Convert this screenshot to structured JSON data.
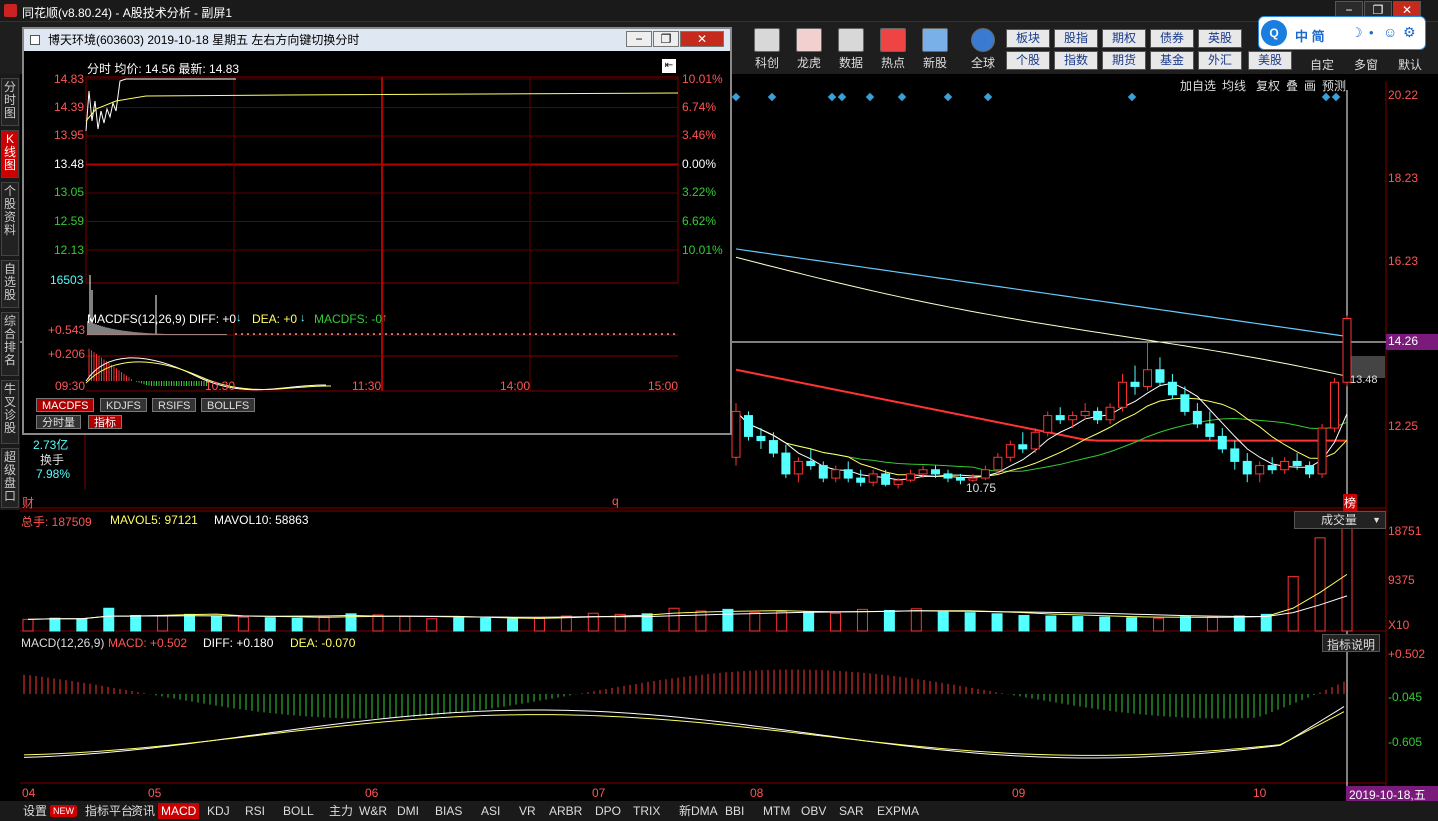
{
  "window": {
    "title": "同花顺(v8.80.24) - A股技术分析 - 副屏1",
    "controls": [
      "−",
      "❐",
      "✕"
    ]
  },
  "toolbar": {
    "tools": [
      {
        "label": "科创",
        "icon": "chart-icon"
      },
      {
        "label": "龙虎",
        "icon": "dragon-icon"
      },
      {
        "label": "数据",
        "icon": "pe-icon"
      },
      {
        "label": "热点",
        "icon": "hot-icon"
      },
      {
        "label": "新股",
        "icon": "ipo-icon"
      },
      {
        "label": "全球",
        "icon": "globe-icon"
      }
    ],
    "market_row1": [
      "板块",
      "股指",
      "期权",
      "债券",
      "英股"
    ],
    "market_row2": [
      "个股",
      "指数",
      "期货",
      "基金",
      "外汇",
      "美股"
    ],
    "right_tools": [
      "自定",
      "多窗",
      "默认"
    ],
    "search_text": "中 简"
  },
  "leftnav": [
    {
      "label": "分时图",
      "active": false
    },
    {
      "label": "K线图",
      "active": true
    },
    {
      "label": "个股资料",
      "active": false
    },
    {
      "label": "自选股",
      "active": false
    },
    {
      "label": "综合排名",
      "active": false
    },
    {
      "label": "牛叉诊股",
      "active": false
    },
    {
      "label": "超级盘口",
      "active": false
    }
  ],
  "kline": {
    "top_buttons": [
      "加自选",
      "均线",
      "复权",
      "叠",
      "画",
      "预测"
    ],
    "price_ticks": [
      "20.22",
      "18.23",
      "16.23",
      "14.26",
      "12.25"
    ],
    "current_price_tag": "14.26",
    "marker_label": "13.48",
    "low_label": "10.75",
    "side_info": {
      "amount": "2.73亿",
      "turnover_label": "换手",
      "turnover_value": "7.98%"
    },
    "bottom_markers": [
      "财",
      "q",
      "榜"
    ],
    "candles": [
      [
        11.5,
        12.8,
        11.3,
        12.6
      ],
      [
        12.5,
        12.6,
        11.9,
        12.0
      ],
      [
        12.0,
        12.2,
        11.7,
        11.9
      ],
      [
        11.9,
        12.1,
        11.5,
        11.6
      ],
      [
        11.6,
        11.8,
        11.0,
        11.1
      ],
      [
        11.1,
        11.5,
        10.9,
        11.4
      ],
      [
        11.4,
        11.7,
        11.2,
        11.3
      ],
      [
        11.3,
        11.4,
        10.9,
        11.0
      ],
      [
        11.0,
        11.3,
        10.9,
        11.2
      ],
      [
        11.2,
        11.4,
        10.9,
        11.0
      ],
      [
        11.0,
        11.2,
        10.8,
        10.9
      ],
      [
        10.9,
        11.2,
        10.8,
        11.1
      ],
      [
        11.1,
        11.2,
        10.8,
        10.85
      ],
      [
        10.85,
        11.0,
        10.75,
        10.95
      ],
      [
        10.95,
        11.2,
        10.9,
        11.1
      ],
      [
        11.1,
        11.3,
        11.0,
        11.2
      ],
      [
        11.2,
        11.3,
        11.0,
        11.1
      ],
      [
        11.1,
        11.2,
        10.9,
        11.0
      ],
      [
        11.0,
        11.1,
        10.85,
        10.95
      ],
      [
        10.95,
        11.1,
        10.9,
        11.0
      ],
      [
        11.0,
        11.3,
        10.95,
        11.2
      ],
      [
        11.2,
        11.6,
        11.1,
        11.5
      ],
      [
        11.5,
        11.9,
        11.4,
        11.8
      ],
      [
        11.8,
        12.1,
        11.6,
        11.7
      ],
      [
        11.7,
        12.2,
        11.6,
        12.1
      ],
      [
        12.1,
        12.6,
        12.0,
        12.5
      ],
      [
        12.5,
        12.7,
        12.3,
        12.4
      ],
      [
        12.4,
        12.6,
        12.2,
        12.5
      ],
      [
        12.5,
        12.8,
        12.4,
        12.6
      ],
      [
        12.6,
        12.7,
        12.3,
        12.4
      ],
      [
        12.4,
        12.8,
        12.3,
        12.7
      ],
      [
        12.7,
        13.5,
        12.6,
        13.3
      ],
      [
        13.3,
        13.7,
        13.0,
        13.2
      ],
      [
        13.2,
        14.3,
        13.1,
        13.6
      ],
      [
        13.6,
        13.9,
        13.2,
        13.3
      ],
      [
        13.3,
        13.5,
        12.9,
        13.0
      ],
      [
        13.0,
        13.2,
        12.5,
        12.6
      ],
      [
        12.6,
        12.8,
        12.2,
        12.3
      ],
      [
        12.3,
        12.6,
        11.9,
        12.0
      ],
      [
        12.0,
        12.2,
        11.6,
        11.7
      ],
      [
        11.7,
        11.9,
        11.2,
        11.4
      ],
      [
        11.4,
        11.6,
        10.9,
        11.1
      ],
      [
        11.1,
        11.4,
        10.9,
        11.3
      ],
      [
        11.3,
        11.5,
        11.1,
        11.2
      ],
      [
        11.2,
        11.5,
        11.1,
        11.4
      ],
      [
        11.4,
        11.6,
        11.2,
        11.3
      ],
      [
        11.3,
        11.4,
        11.0,
        11.1
      ],
      [
        11.1,
        12.3,
        11.0,
        12.2
      ],
      [
        12.2,
        13.4,
        12.1,
        13.3
      ],
      [
        13.3,
        14.9,
        13.2,
        14.83
      ]
    ]
  },
  "volume": {
    "label_total": "总手: 187509",
    "label_ma5": "MAVOL5: 97121",
    "label_ma10": "MAVOL10: 58863",
    "dropdown": "成交量",
    "ticks": [
      "18751",
      "9375",
      "X10"
    ],
    "bars": [
      2100,
      2300,
      2200,
      4100,
      2800,
      2700,
      3000,
      2600,
      2500,
      2400,
      2300,
      2500,
      3100,
      2900,
      2600,
      2200,
      2400,
      2300,
      2200,
      2300,
      2700,
      3200,
      3000,
      3100,
      4100,
      3600,
      3900,
      3300,
      3500,
      3400,
      3200,
      3900,
      3700,
      4000,
      3400,
      3300,
      3100,
      2800,
      2700,
      2600,
      2500,
      2400,
      2300,
      2600,
      2500,
      2700,
      3000,
      9800,
      16800,
      18751
    ]
  },
  "macd": {
    "label_title": "MACD(12,26,9)",
    "label_macd": "MACD: +0.502",
    "label_diff": "DIFF: +0.180",
    "label_dea": "DEA: -0.070",
    "button": "指标说明",
    "ticks": [
      "+0.502",
      "-0.045",
      "-0.605"
    ],
    "date_ticks": [
      "04",
      "05",
      "06",
      "07",
      "08",
      "09",
      "10"
    ],
    "date_highlight": "2019-10-18,五"
  },
  "popup": {
    "title": "博天环境(603603) 2019-10-18 星期五    左右方向键切换分时",
    "header": "分时  均价: 14.56  最新: 14.83",
    "price_ticks_left": [
      "14.83",
      "14.39",
      "13.95",
      "13.48",
      "13.05",
      "12.59",
      "12.13"
    ],
    "pct_ticks_right": [
      "10.01%",
      "6.74%",
      "3.46%",
      "0.00%",
      "3.22%",
      "6.62%",
      "10.01%"
    ],
    "vol_tick": "16503",
    "ind_header": "MACDFS(12,26,9)  DIFF: +0",
    "ind_dea": "DEA: +0",
    "ind_macdfs": "MACDFS: -0",
    "ind_ticks": [
      "+0.543",
      "+0.206"
    ],
    "time_ticks": [
      "09:30",
      "10:30",
      "11:30",
      "14:00",
      "15:00"
    ],
    "tabs": [
      "MACDFS",
      "KDJFS",
      "RSIFS",
      "BOLLFS"
    ],
    "tabs2": [
      "分时量",
      "指标"
    ]
  },
  "bottombar": [
    {
      "label": "设置",
      "active": false
    },
    {
      "label": "NEW",
      "active": false
    },
    {
      "label": "指标平台",
      "active": false
    },
    {
      "label": "资讯",
      "active": false
    },
    {
      "label": "MACD",
      "active": true
    },
    {
      "label": "KDJ",
      "active": false
    },
    {
      "label": "RSI",
      "active": false
    },
    {
      "label": "BOLL",
      "active": false
    },
    {
      "label": "主力",
      "active": false
    },
    {
      "label": "W&R",
      "active": false
    },
    {
      "label": "DMI",
      "active": false
    },
    {
      "label": "BIAS",
      "active": false
    },
    {
      "label": "ASI",
      "active": false
    },
    {
      "label": "VR",
      "active": false
    },
    {
      "label": "ARBR",
      "active": false
    },
    {
      "label": "DPO",
      "active": false
    },
    {
      "label": "TRIX",
      "active": false
    },
    {
      "label": "新DMA",
      "active": false
    },
    {
      "label": "BBI",
      "active": false
    },
    {
      "label": "MTM",
      "active": false
    },
    {
      "label": "OBV",
      "active": false
    },
    {
      "label": "SAR",
      "active": false
    },
    {
      "label": "EXPMA",
      "active": false
    }
  ],
  "colors": {
    "up": "#ff3333",
    "down": "#54ffff",
    "ma_white": "#ffffff",
    "ma_yellow": "#ffff66",
    "ma_green": "#33cc33",
    "ma_red": "#ff3333",
    "ma_cyan": "#66ccff"
  }
}
